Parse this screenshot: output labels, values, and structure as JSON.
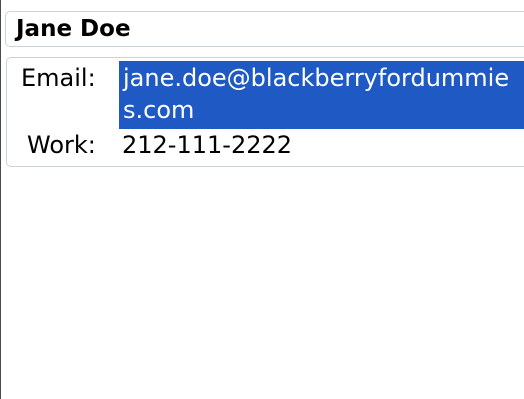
{
  "contact": {
    "name": "Jane Doe",
    "fields": {
      "email_label": "Email:",
      "email_value": "jane.doe@blackberryfordummies.com",
      "work_label": "Work:",
      "work_value": "212-111-2222"
    }
  },
  "colors": {
    "selection": "#1f59c4",
    "card_border": "#c9d3dd"
  }
}
